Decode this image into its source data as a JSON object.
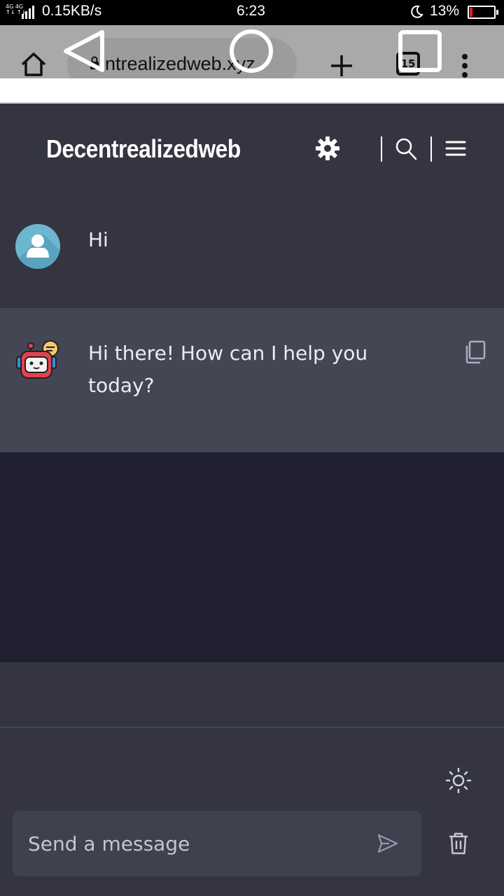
{
  "status_bar": {
    "network": "4G 4G",
    "speed": "0.15KB/s",
    "time": "6:23",
    "battery": "13%"
  },
  "browser": {
    "url": "ntrealizedweb.xyz",
    "tab_count": "15"
  },
  "header": {
    "title": "Decentrealizedweb"
  },
  "messages": [
    {
      "role": "user",
      "text": "Hi"
    },
    {
      "role": "assistant",
      "text": "Hi there! How can I help you today?"
    }
  ],
  "composer": {
    "placeholder": "Send a message"
  },
  "colors": {
    "background": "#343541",
    "assistant_row": "#444654",
    "empty_area": "#202030",
    "input_background": "#40414f",
    "text": "#ececf1"
  }
}
